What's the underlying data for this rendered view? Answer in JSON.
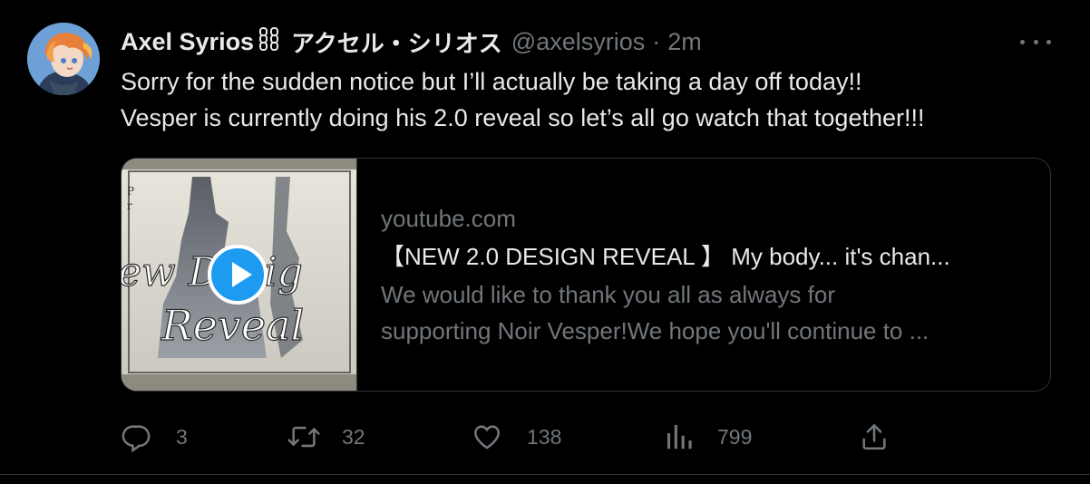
{
  "tweet": {
    "display_name": "Axel Syrios",
    "display_name_jp": "アクセル・シリオス",
    "handle": "@axelsyrios",
    "separator": "·",
    "time": "2m",
    "text_lines": [
      "Sorry for the sudden notice but I’ll actually be taking a day off today!!",
      "Vesper is currently doing his 2.0 reveal so let’s all go watch that together!!!"
    ]
  },
  "card": {
    "domain": "youtube.com",
    "title": "【NEW 2.0 DESIGN REVEAL 】 My body... it's chan...",
    "description_lines": [
      "We would like to thank you all as always for",
      "supporting Noir Vesper!We hope you'll continue to ..."
    ],
    "thumbnail_text": "New Design Reveal"
  },
  "actions": {
    "reply_count": "3",
    "retweet_count": "32",
    "like_count": "138",
    "views_count": "799"
  },
  "colors": {
    "background": "#000000",
    "text": "#e7e9ea",
    "muted": "#71767b",
    "border": "#2f3336",
    "accent": "#1d9bf0"
  },
  "icons": [
    "chain-icon",
    "more-icon",
    "play-icon",
    "reply-icon",
    "retweet-icon",
    "like-icon",
    "views-icon",
    "share-icon"
  ]
}
